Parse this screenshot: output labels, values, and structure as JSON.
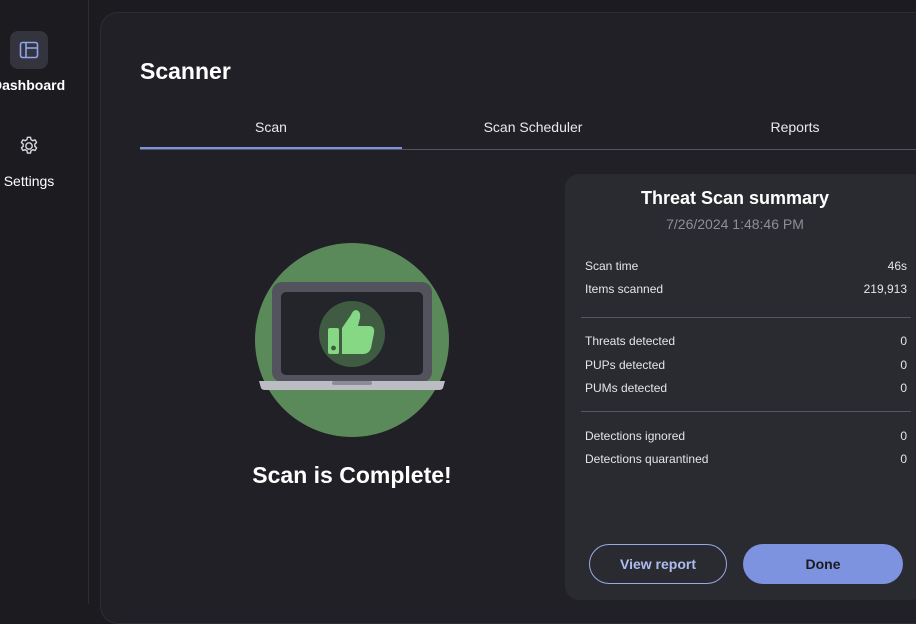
{
  "sidebar": {
    "items": [
      {
        "label": "Dashboard",
        "icon": "dashboard-icon",
        "active": true
      },
      {
        "label": "Settings",
        "icon": "gear-icon",
        "active": false
      }
    ]
  },
  "header": {
    "title": "Scanner"
  },
  "tabs": [
    {
      "label": "Scan",
      "active": true
    },
    {
      "label": "Scan Scheduler",
      "active": false
    },
    {
      "label": "Reports",
      "active": false
    }
  ],
  "scan_status": {
    "message": "Scan is Complete!",
    "illustration_icon": "laptop-thumbs-up-icon"
  },
  "summary": {
    "title": "Threat Scan summary",
    "datetime": "7/26/2024 1:48:46 PM",
    "rows": [
      {
        "label": "Scan time",
        "value": "46s"
      },
      {
        "label": "Items scanned",
        "value": "219,913"
      },
      {
        "label": "Threats detected",
        "value": "0"
      },
      {
        "label": "PUPs detected",
        "value": "0"
      },
      {
        "label": "PUMs detected",
        "value": "0"
      },
      {
        "label": "Detections ignored",
        "value": "0"
      },
      {
        "label": "Detections quarantined",
        "value": "0"
      }
    ]
  },
  "actions": {
    "view_report": "View report",
    "done": "Done"
  },
  "colors": {
    "accent": "#7d93e0",
    "background": "#1b1b20",
    "panel": "#202026",
    "card": "#2a2b31",
    "success_green": "#5a8a5a",
    "thumb_green": "#86d884"
  }
}
